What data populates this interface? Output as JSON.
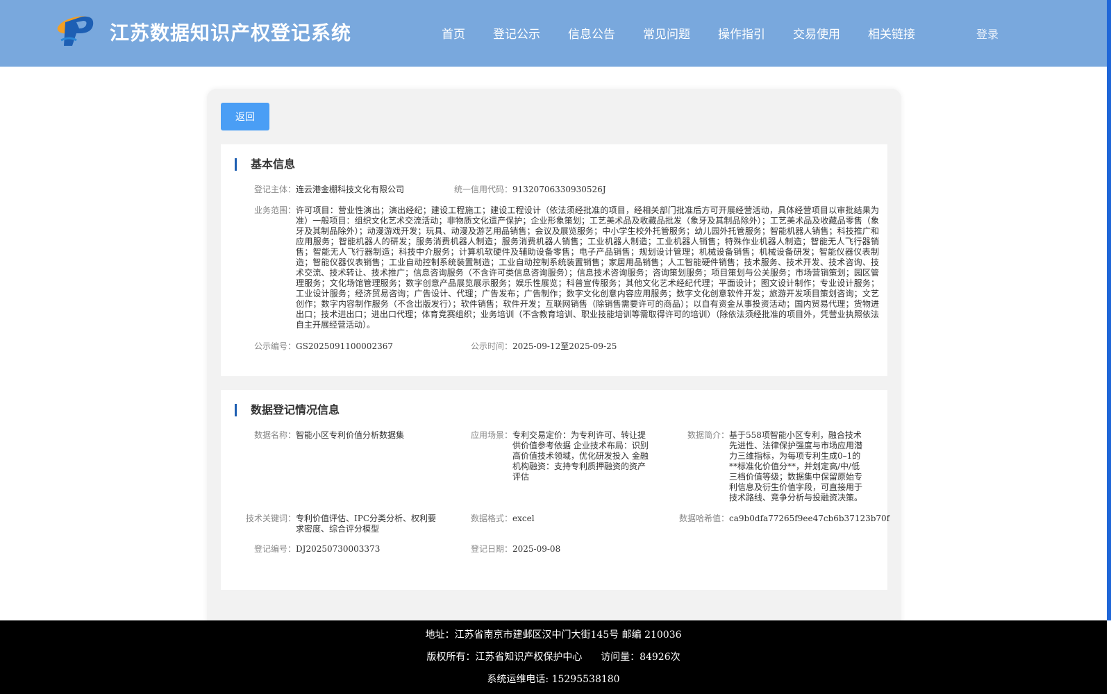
{
  "header": {
    "title": "江苏数据知识产权登记系统",
    "nav": [
      "首页",
      "登记公示",
      "信息公告",
      "常见问题",
      "操作指引",
      "交易使用",
      "相关链接"
    ],
    "login": "登录"
  },
  "back_button": "返回",
  "basic_info": {
    "title": "基本信息",
    "subject_label": "登记主体：",
    "subject_value": "连云港金棚科技文化有限公司",
    "credit_label": "统一信用代码：",
    "credit_value": "91320706330930526J",
    "scope_label": "业务范围：",
    "scope_value": "许可项目：营业性演出；演出经纪；建设工程施工；建设工程设计（依法须经批准的项目，经相关部门批准后方可开展经营活动，具体经营项目以审批结果为准）一般项目：组织文化艺术交流活动；非物质文化遗产保护；企业形象策划；工艺美术品及收藏品批发（象牙及其制品除外）；工艺美术品及收藏品零售（象牙及其制品除外）；动漫游戏开发；玩具、动漫及游艺用品销售；会议及展览服务；中小学生校外托管服务；幼儿园外托管服务；智能机器人销售；科技推广和应用服务；智能机器人的研发；服务消费机器人制造；服务消费机器人销售；工业机器人制造；工业机器人销售；特殊作业机器人制造；智能无人飞行器销售；智能无人飞行器制造；科技中介服务；计算机软硬件及辅助设备零售；电子产品销售；规划设计管理；机械设备销售；机械设备研发；智能仪器仪表制造；智能仪器仪表销售；工业自动控制系统装置制造；工业自动控制系统装置销售；家居用品销售；人工智能硬件销售；技术服务、技术开发、技术咨询、技术交流、技术转让、技术推广；信息咨询服务（不含许可类信息咨询服务）；信息技术咨询服务；咨询策划服务；项目策划与公关服务；市场营销策划；园区管理服务；文化场馆管理服务；数字创意产品展览展示服务；娱乐性展览；科普宣传服务；其他文化艺术经纪代理；平面设计；图文设计制作；专业设计服务；工业设计服务；经济贸易咨询；广告设计、代理；广告发布；广告制作；数字文化创意内容应用服务；数字文化创意软件开发；旅游开发项目策划咨询；文艺创作；数字内容制作服务（不含出版发行）；软件销售；软件开发；互联网销售（除销售需要许可的商品）；以自有资金从事投资活动；国内贸易代理；货物进出口；技术进出口；进出口代理；体育竞赛组织；业务培训（不含教育培训、职业技能培训等需取得许可的培训）（除依法须经批准的项目外，凭营业执照依法自主开展经营活动）。",
    "pub_no_label": "公示编号：",
    "pub_no_value": "GS2025091100002367",
    "pub_time_label": "公示时间：",
    "pub_time_value": "2025-09-12至2025-09-25"
  },
  "data_info": {
    "title": "数据登记情况信息",
    "name_label": "数据名称：",
    "name_value": "智能小区专利价值分析数据集",
    "scene_label": "应用场景：",
    "scene_value": "专利交易定价：为专利许可、转让提供价值参考依据 企业技术布局：识别高价值技术领域，优化研发投入 金融机构融资：支持专利质押融资的资产评估",
    "intro_label": "数据简介：",
    "intro_value": "基于558项智能小区专利，融合技术先进性、法律保护强度与市场应用潜力三维指标，为每项专利生成0–1的**标准化价值分**，并划定高/中/低三档价值等级；数据集中保留原始专利信息及衍生价值字段，可直接用于技术路线、竞争分析与投融资决策。",
    "keywords_label": "技术关键词：",
    "keywords_value": "专利价值评估、IPC分类分析、权利要求密度、综合评分模型",
    "format_label": "数据格式：",
    "format_value": "excel",
    "hash_label": "数据哈希值：",
    "hash_value": "ca9b0dfa77265f9ee47cb6b37123b70f",
    "reg_no_label": "登记编号：",
    "reg_no_value": "DJ20250730003373",
    "reg_date_label": "登记日期：",
    "reg_date_value": "2025-09-08"
  },
  "footer": {
    "address": "地址：江苏省南京市建邺区汉中门大街145号 邮编 210036",
    "copyright": "版权所有：江苏省知识产权保护中心",
    "visits": "访问量：84926次",
    "phone": "系统运维电话: 15295538180"
  },
  "colors": {
    "header_bg": "#79a8dd",
    "accent": "#4a9ef5",
    "section_marker": "#1f5fb2",
    "footer_bg": "#000000"
  },
  "icons": {
    "logo": "logo-icon"
  }
}
